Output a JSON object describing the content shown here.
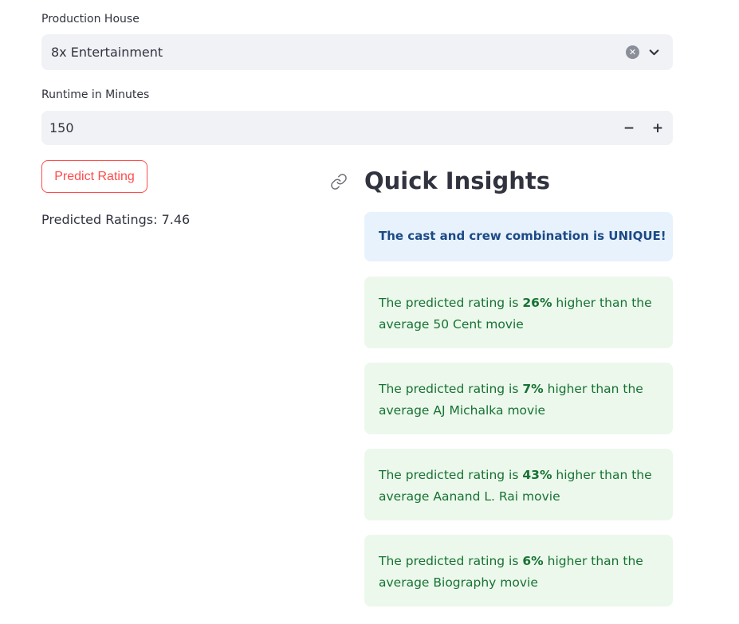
{
  "production_house": {
    "label": "Production House",
    "value": "8x Entertainment"
  },
  "runtime": {
    "label": "Runtime in Minutes",
    "value": "150",
    "decrement": "−",
    "increment": "+"
  },
  "predict": {
    "button_label": "Predict Rating",
    "result": "Predicted Ratings: 7.46"
  },
  "insights": {
    "heading": "Quick Insights",
    "info": "The cast and crew combination is UNIQUE!",
    "items": [
      {
        "prefix": "The predicted rating is ",
        "percent": "26%",
        "suffix": " higher than the average 50 Cent movie"
      },
      {
        "prefix": "The predicted rating is ",
        "percent": "7%",
        "suffix": " higher than the average AJ Michalka movie"
      },
      {
        "prefix": "The predicted rating is ",
        "percent": "43%",
        "suffix": " higher than the average Aanand L. Rai movie"
      },
      {
        "prefix": "The predicted rating is ",
        "percent": "6%",
        "suffix": " higher than the average Biography movie"
      }
    ]
  },
  "colors": {
    "accent": "#ff4b4b",
    "input_bg": "#f0f2f6",
    "info_bg": "#e8f2fc",
    "info_text": "#1c4a86",
    "success_bg": "#ecf8ec",
    "success_text": "#177233"
  },
  "icons": [
    "clear-icon",
    "chevron-down-icon",
    "link-icon"
  ]
}
